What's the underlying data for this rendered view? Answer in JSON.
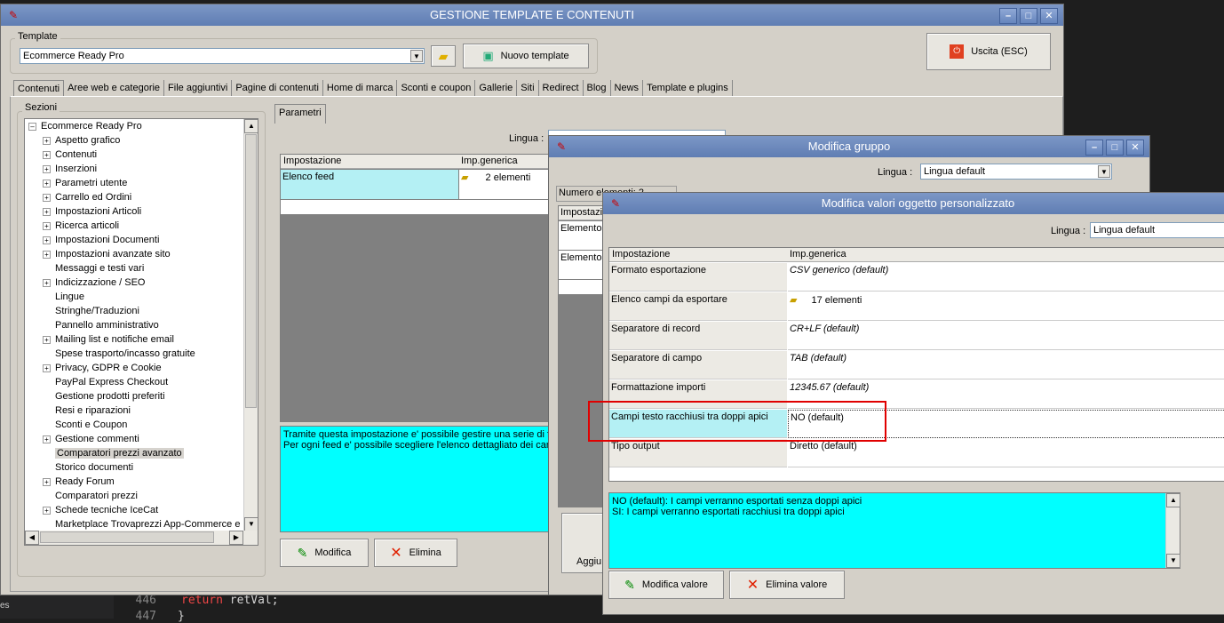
{
  "code": {
    "lines": [
      {
        "number": "446",
        "keyword": "return",
        "text": " retVal;"
      },
      {
        "number": "447",
        "keyword": "",
        "text": "}"
      }
    ],
    "side_text": "es"
  },
  "main_window": {
    "title": "GESTIONE TEMPLATE E CONTENUTI",
    "template_label": "Template",
    "template_value": "Ecommerce Ready Pro",
    "new_template_label": "Nuovo template",
    "exit_label": "Uscita (ESC)",
    "tabs": [
      "Contenuti",
      "Aree web e categorie",
      "File aggiuntivi",
      "Pagine di contenuti",
      "Home di marca",
      "Sconti e coupon",
      "Gallerie",
      "Siti",
      "Redirect",
      "Blog",
      "News",
      "Template e plugins"
    ],
    "sections_label": "Sezioni",
    "tree_root": "Ecommerce Ready Pro",
    "tree_items": [
      {
        "label": "Aspetto grafico",
        "expand": true
      },
      {
        "label": "Contenuti",
        "expand": true
      },
      {
        "label": "Inserzioni",
        "expand": true
      },
      {
        "label": "Parametri utente",
        "expand": true
      },
      {
        "label": "Carrello ed Ordini",
        "expand": true
      },
      {
        "label": "Impostazioni Articoli",
        "expand": true
      },
      {
        "label": "Ricerca articoli",
        "expand": true
      },
      {
        "label": "Impostazioni Documenti",
        "expand": true
      },
      {
        "label": "Impostazioni avanzate sito",
        "expand": true
      },
      {
        "label": "Messaggi e testi vari",
        "expand": false
      },
      {
        "label": "Indicizzazione / SEO",
        "expand": true
      },
      {
        "label": "Lingue",
        "expand": false
      },
      {
        "label": "Stringhe/Traduzioni",
        "expand": false
      },
      {
        "label": "Pannello amministrativo",
        "expand": false
      },
      {
        "label": "Mailing list e notifiche email",
        "expand": true
      },
      {
        "label": "Spese trasporto/incasso gratuite",
        "expand": false
      },
      {
        "label": "Privacy, GDPR e Cookie",
        "expand": true
      },
      {
        "label": "PayPal Express Checkout",
        "expand": false
      },
      {
        "label": "Gestione prodotti preferiti",
        "expand": false
      },
      {
        "label": "Resi e riparazioni",
        "expand": false
      },
      {
        "label": "Sconti e Coupon",
        "expand": false
      },
      {
        "label": "Gestione commenti",
        "expand": true
      },
      {
        "label": "Comparatori prezzi avanzato",
        "expand": false,
        "selected": true
      },
      {
        "label": "Storico documenti",
        "expand": false
      },
      {
        "label": "Ready Forum",
        "expand": true
      },
      {
        "label": "Comparatori prezzi",
        "expand": false
      },
      {
        "label": "Schede tecniche IceCat",
        "expand": true
      },
      {
        "label": "Marketplace Trovaprezzi App-Commerce e Ki",
        "expand": false
      }
    ],
    "params_tab": "Parametri",
    "lingua_label": "Lingua :",
    "grid_headers": [
      "Impostazione",
      "Imp.generica"
    ],
    "grid_row": {
      "name": "Elenco feed",
      "value": "2 elementi"
    },
    "description": [
      "Tramite questa impostazione e' possibile gestire una serie di fe",
      "Per ogni feed e' possibile scegliere l'elenco dettagliato dei camp"
    ],
    "modify_label": "Modifica",
    "delete_label": "Elimina"
  },
  "group_window": {
    "title": "Modifica gruppo",
    "lingua_label": "Lingua :",
    "lingua_value": "Lingua default",
    "count_label": "Numero elementi: 2",
    "grid_header": "Impostazione",
    "rows": [
      "Elemento",
      "Elemento"
    ],
    "add_label": "Aggiu"
  },
  "values_window": {
    "title": "Modifica valori oggetto personalizzato",
    "lingua_label": "Lingua :",
    "lingua_value": "Lingua default",
    "grid_headers": [
      "Impostazione",
      "Imp.generica"
    ],
    "rows": [
      {
        "name": "Formato esportazione",
        "value": "CSV generico (default)",
        "italic": true
      },
      {
        "name": "Elenco campi da esportare",
        "value": "17 elementi",
        "italic": false,
        "icon": true
      },
      {
        "name": "Separatore di record",
        "value": "CR+LF (default)",
        "italic": true
      },
      {
        "name": "Separatore di campo",
        "value": "TAB (default)",
        "italic": true
      },
      {
        "name": "Formattazione importi",
        "value": "12345.67 (default)",
        "italic": true
      },
      {
        "name": "Campi testo racchiusi tra doppi apici",
        "value": "NO (default)",
        "italic": false,
        "selected": true
      },
      {
        "name": "Tipo output",
        "value": "Diretto (default)",
        "italic": false
      }
    ],
    "description": [
      "NO (default): I campi verranno esportati senza doppi apici",
      "SI: I campi verranno esportati racchiusi tra doppi apici"
    ],
    "modify_value_label": "Modifica valore",
    "delete_value_label": "Elimina valore"
  },
  "colors": {
    "highlight_box": "#e00000",
    "cyan": "#00ffff",
    "titlebar": "#6a88bd"
  }
}
